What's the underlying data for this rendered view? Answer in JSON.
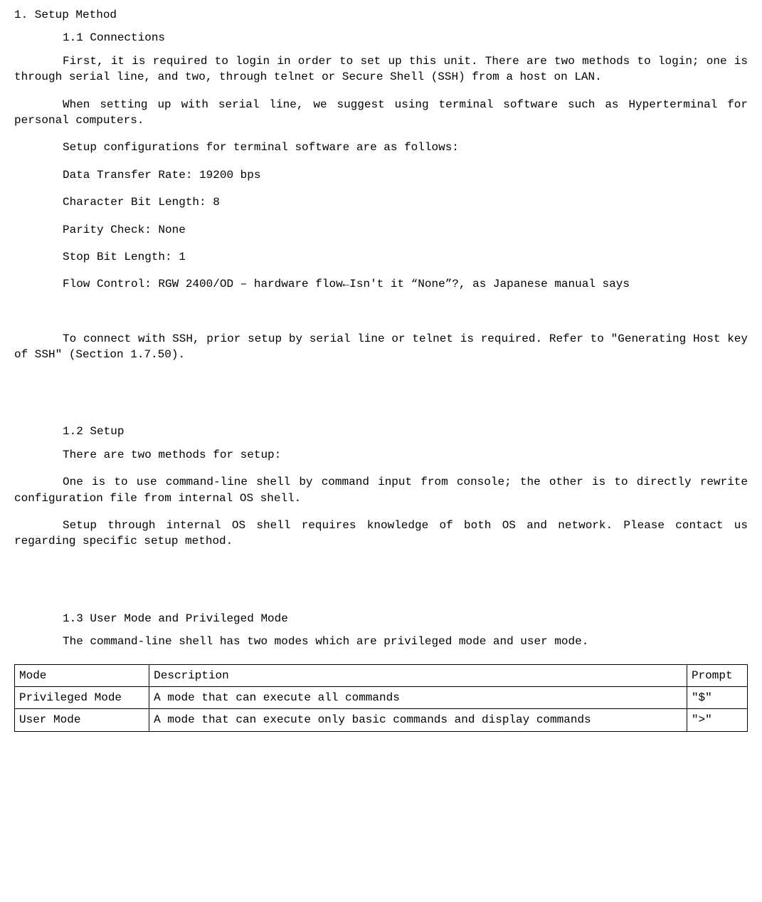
{
  "h1": "1. Setup Method",
  "s11": {
    "title": "1.1 Connections",
    "p1": "First, it is required to login in order to set up this unit. There are two methods to login; one is through serial line, and two, through telnet or Secure Shell (SSH) from a host on LAN.",
    "p2": "When setting up with serial line, we suggest using terminal software such as Hyperterminal for personal computers.",
    "p3": "Setup configurations for terminal software are as follows:",
    "cfg": {
      "rate": "Data Transfer Rate: 19200 bps",
      "charbit": "Character Bit Length: 8",
      "parity": "Parity Check: None",
      "stopbit": "Stop Bit Length: 1",
      "flow": "Flow Control: RGW 2400/OD – hardware flow←Isn't it “None”?, as Japanese manual says"
    },
    "p4": "To connect with SSH, prior setup by serial line or telnet is required. Refer to \"Generating Host key of SSH\" (Section 1.7.50)."
  },
  "s12": {
    "title": "1.2  Setup",
    "p1": "There are two methods for setup:",
    "p2": "One is to use command-line shell by command input from console; the other is to directly rewrite configuration file from internal OS shell.",
    "p3": "Setup through internal OS shell requires knowledge of both OS and network. Please contact us regarding specific setup method."
  },
  "s13": {
    "title": "1.3  User Mode and Privileged Mode",
    "p1": "The command-line shell has two modes which are privileged mode and user mode."
  },
  "table": {
    "headers": {
      "mode": "Mode",
      "desc": "Description",
      "prompt": "Prompt"
    },
    "rows": [
      {
        "mode": "Privileged Mode",
        "desc": "A mode that can execute all commands",
        "prompt": "\"$\""
      },
      {
        "mode": "User Mode",
        "desc": "A mode that can execute only basic commands and display commands",
        "prompt": "\">\""
      }
    ]
  }
}
